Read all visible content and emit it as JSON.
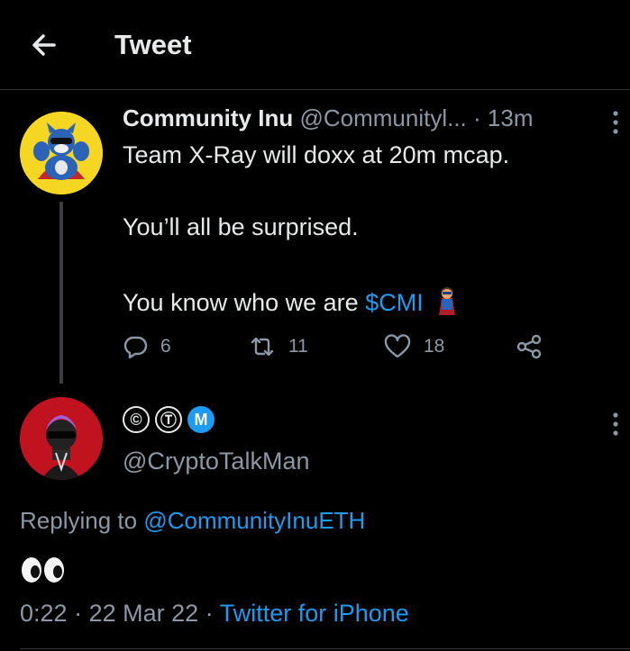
{
  "header": {
    "title": "Tweet"
  },
  "parent_tweet": {
    "display_name": "Community Inu",
    "handle": "@Communityl...",
    "separator": "·",
    "time": "13m",
    "lines": [
      "Team X-Ray will doxx at 20m mcap.",
      "You’ll all be surprised.",
      "You know who we are"
    ],
    "cashtag": "$CMI",
    "emoji": "superhero",
    "reply_count": "6",
    "retweet_count": "11",
    "like_count": "18"
  },
  "reply_tweet": {
    "badges": [
      "©",
      "Ⓣ",
      "M"
    ],
    "handle": "@CryptoTalkMan",
    "replying_label": "Replying to",
    "replying_to": "@CommunityInuETH",
    "body_emoji": "eyes",
    "time": "0:22",
    "dot": "·",
    "date": "22 Mar 22",
    "dot2": "·",
    "source": "Twitter for iPhone"
  },
  "colors": {
    "background": "#000000",
    "text": "#e7e9ea",
    "muted": "#8b98a5",
    "link": "#1d9bf0",
    "border": "#2f3336"
  }
}
